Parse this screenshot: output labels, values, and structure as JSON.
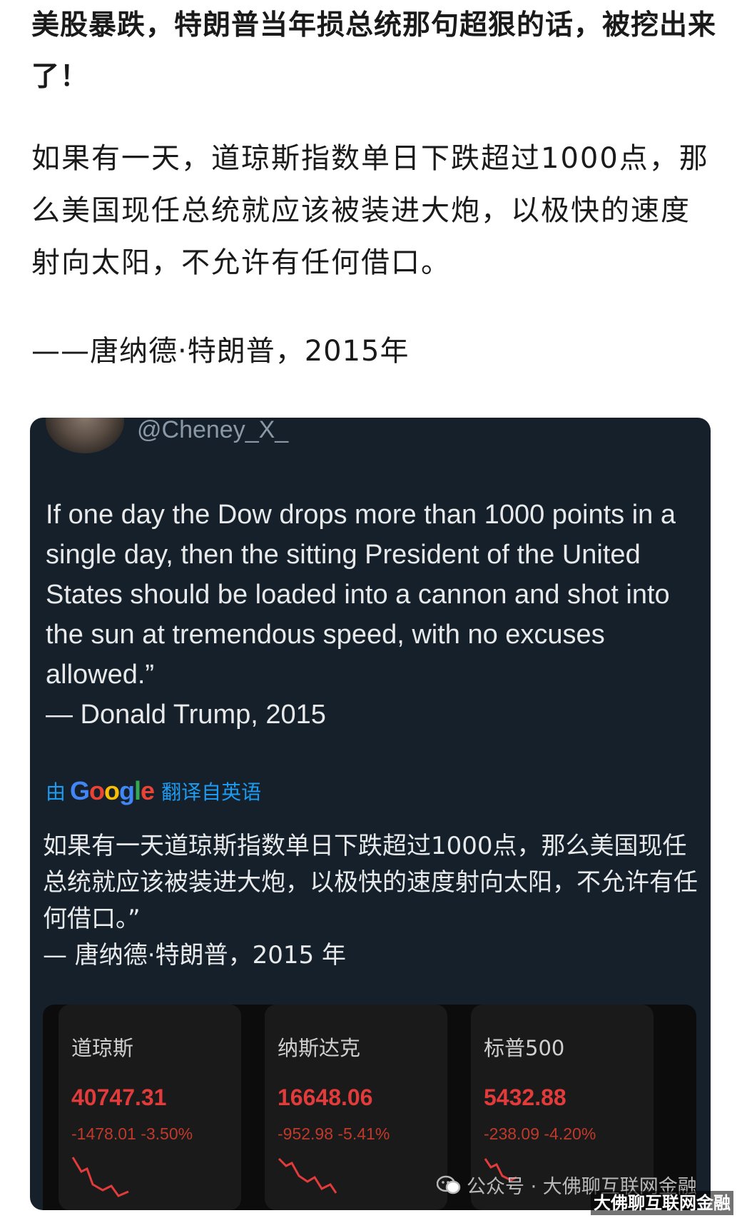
{
  "article": {
    "title": "美股暴跌，特朗普当年损总统那句超狠的话，被挖出来了！",
    "paragraph": "如果有一天，道琼斯指数单日下跌超过1000点，那么美国现任总统就应该被装进大炮，以极快的速度射向太阳，不允许有任何借口。",
    "signature": "——唐纳德·特朗普，2015年"
  },
  "tweet": {
    "handle": "@Cheney_X_",
    "english_lines": [
      "If one day the Dow drops more than 1000 points in a single day, then the sitting President of the United States should be loaded into a cannon and shot into the sun at tremendous speed, with no excuses allowed.”",
      "— Donald Trump, 2015"
    ],
    "translate_by": "由",
    "translate_google": "Google",
    "translate_suffix": "翻译自英语",
    "chinese_lines": [
      "如果有一天道琼斯指数单日下跌超过1000点，那么美国现任总统就应该被装进大炮，以极快的速度射向太阳，不允许有任何借口。”",
      "— 唐纳德·特朗普，2015 年"
    ]
  },
  "markets": [
    {
      "name": "道琼斯",
      "value": "40747.31",
      "change": "-1478.01 -3.50%"
    },
    {
      "name": "纳斯达克",
      "value": "16648.06",
      "change": "-952.98 -5.41%"
    },
    {
      "name": "标普500",
      "value": "5432.88",
      "change": "-238.09 -4.20%"
    }
  ],
  "watermark": {
    "text": "公众号 · 大佛聊互联网金融",
    "corner": "大佛聊互联网金融"
  },
  "colors": {
    "card_bg": "#15202b",
    "translate_link": "#1d9bf0",
    "loss_red": "#e23b3b"
  }
}
